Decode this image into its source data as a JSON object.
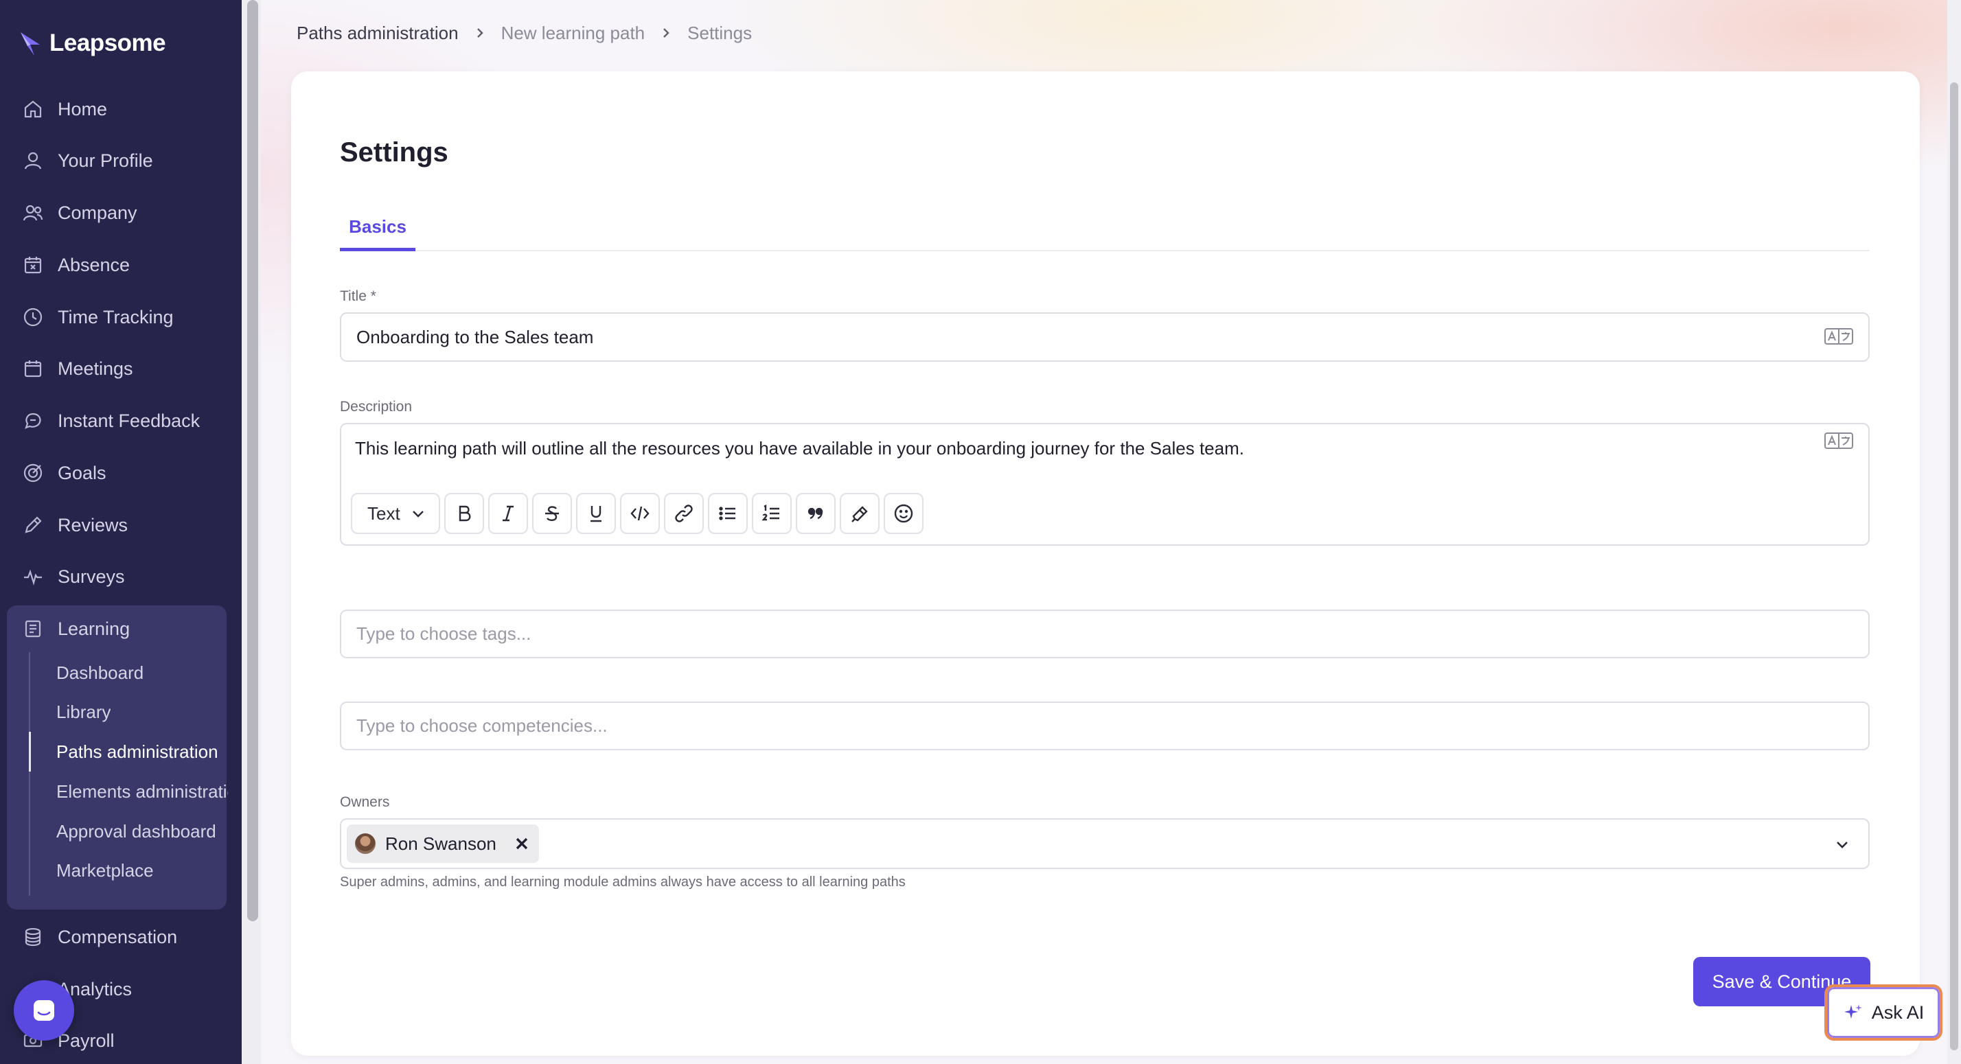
{
  "app": {
    "brand": "Leapsome",
    "accent_color": "#5a49e0",
    "sidebar_color": "#26244a"
  },
  "breadcrumb": [
    "Paths administration",
    "New learning path",
    "Settings"
  ],
  "sidebar": {
    "items": [
      {
        "label": "Home",
        "icon": "home-icon"
      },
      {
        "label": "Your Profile",
        "icon": "user-icon"
      },
      {
        "label": "Company",
        "icon": "users-icon"
      },
      {
        "label": "Absence",
        "icon": "calendar-x-icon"
      },
      {
        "label": "Time Tracking",
        "icon": "clock-icon"
      },
      {
        "label": "Meetings",
        "icon": "calendar-icon"
      },
      {
        "label": "Instant Feedback",
        "icon": "chat-icon"
      },
      {
        "label": "Goals",
        "icon": "target-icon"
      },
      {
        "label": "Reviews",
        "icon": "pencil-icon"
      },
      {
        "label": "Surveys",
        "icon": "pulse-icon"
      },
      {
        "label": "Learning",
        "icon": "book-icon"
      },
      {
        "label": "Compensation",
        "icon": "coins-icon"
      },
      {
        "label": "Analytics",
        "icon": "chart-icon"
      },
      {
        "label": "Payroll",
        "icon": "payroll-icon"
      }
    ],
    "learning_sub": [
      "Dashboard",
      "Library",
      "Paths administration",
      "Elements administration",
      "Approval dashboard",
      "Marketplace"
    ],
    "active_sub": "Paths administration"
  },
  "page": {
    "title": "Settings",
    "tabs": [
      {
        "label": "Basics",
        "active": true
      }
    ]
  },
  "form": {
    "title_label": "Title *",
    "title_value": "Onboarding to the Sales team",
    "description_label": "Description",
    "description_value": "This learning path will outline all the resources you have available in your onboarding journey for the Sales team.",
    "editor_text_style": "Text",
    "tags_placeholder": "Type to choose tags...",
    "competencies_placeholder": "Type to choose competencies...",
    "owners_label": "Owners",
    "owners": [
      {
        "name": "Ron Swanson"
      }
    ],
    "owners_hint": "Super admins, admins, and learning module admins always have access to all learning paths"
  },
  "actions": {
    "save_label": "Save & Continue",
    "ask_ai_label": "Ask AI"
  }
}
